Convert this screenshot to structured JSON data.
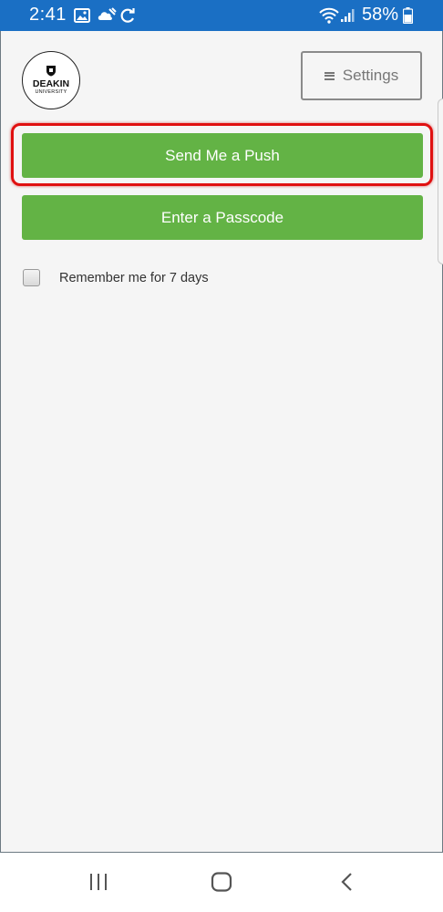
{
  "status_bar": {
    "time": "2:41",
    "battery": "58%",
    "background": "#1a6fc4",
    "icons": [
      "image-icon",
      "weather-icon",
      "sync-icon",
      "wifi-icon",
      "signal-icon",
      "battery-icon"
    ]
  },
  "header": {
    "logo_name": "DEAKIN",
    "logo_sub": "UNIVERSITY",
    "settings_label": "Settings"
  },
  "auth": {
    "push_label": "Send Me a Push",
    "passcode_label": "Enter a Passcode",
    "remember_label": "Remember me for 7 days",
    "remember_checked": false,
    "button_color": "#63b345",
    "highlight_color": "#e01010"
  },
  "nav_bar": {
    "icons": [
      "recent-apps-icon",
      "home-icon",
      "back-icon"
    ]
  }
}
